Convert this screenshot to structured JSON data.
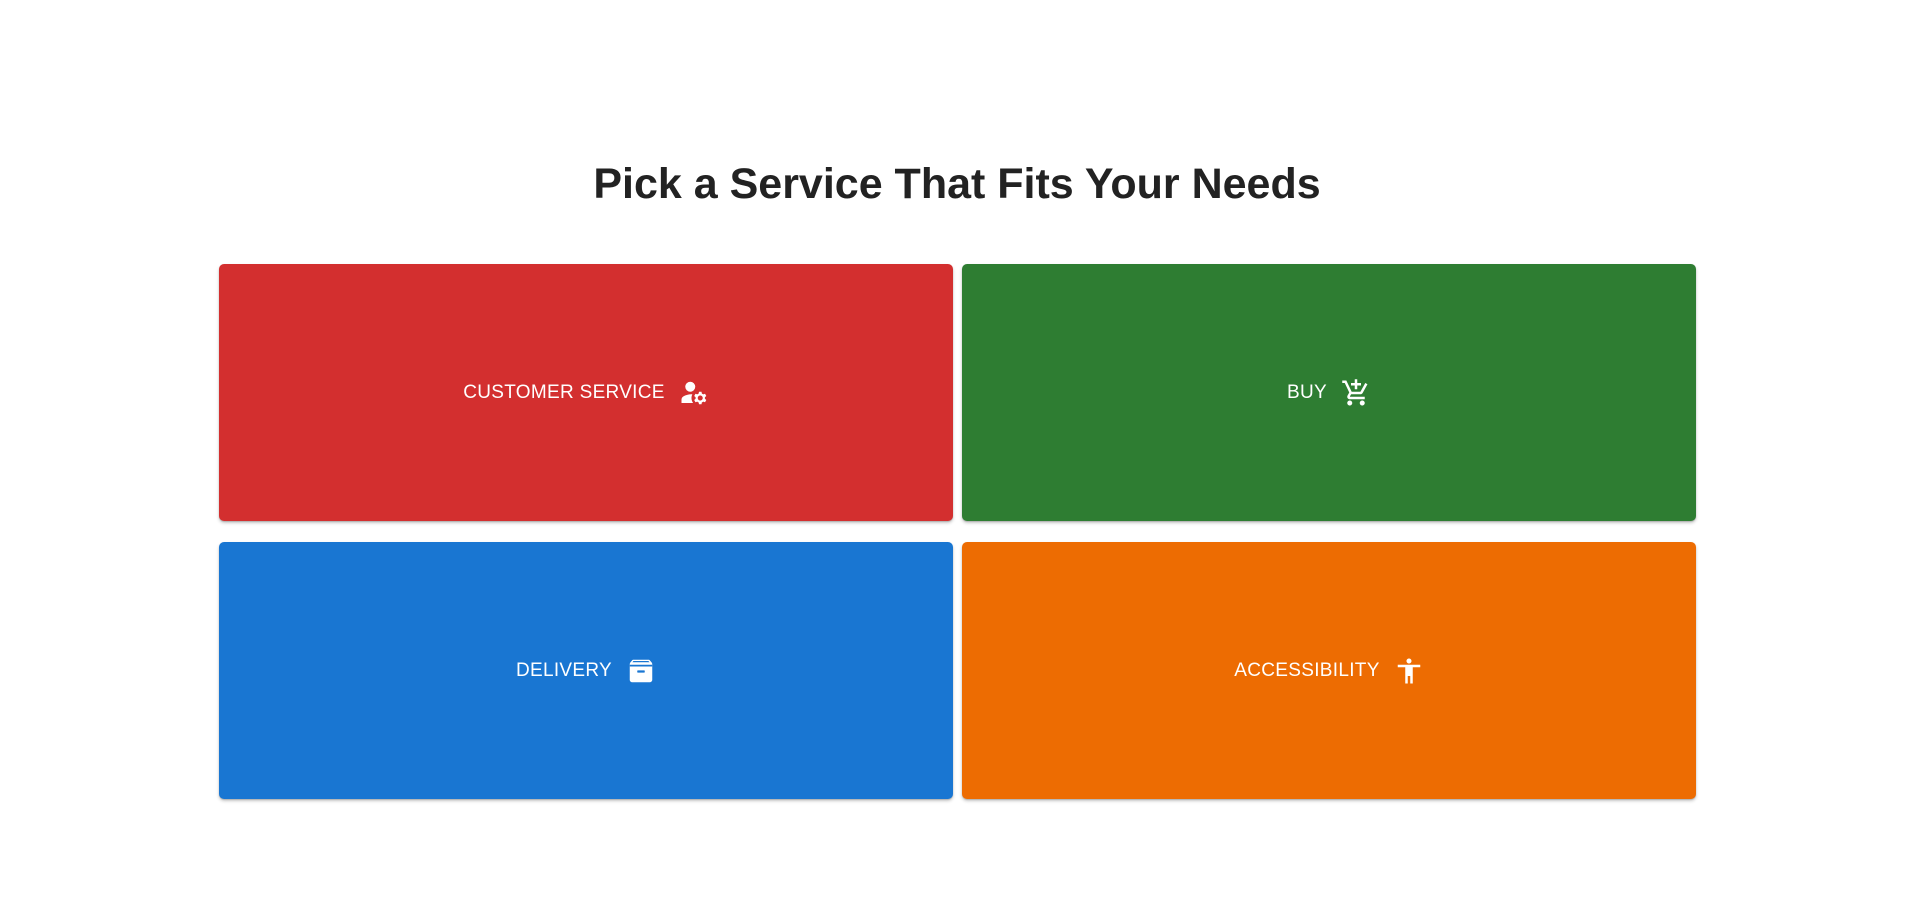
{
  "page": {
    "title": "Pick a Service That Fits Your Needs"
  },
  "tiles": [
    {
      "label": "CUSTOMER SERVICE",
      "icon": "person-gear-icon",
      "color": "#d32f2f"
    },
    {
      "label": "BUY",
      "icon": "add-shopping-cart-icon",
      "color": "#2e7d32"
    },
    {
      "label": "DELIVERY",
      "icon": "archive-box-icon",
      "color": "#1976d2"
    },
    {
      "label": "ACCESSIBILITY",
      "icon": "accessibility-icon",
      "color": "#ed6c02"
    }
  ]
}
